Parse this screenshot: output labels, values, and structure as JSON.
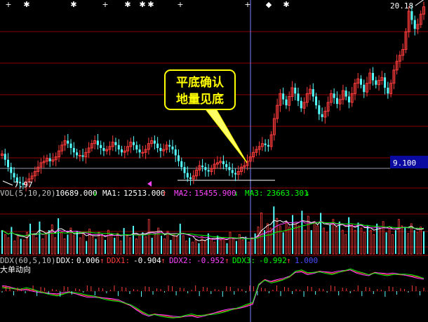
{
  "colors": {
    "background": "#000000",
    "up": "#ff3c3c",
    "down": "#54ffff",
    "grid": "#8b0000",
    "crosshair": "#8080ff",
    "label_white": "#ffffff",
    "ma1": "#ffffff",
    "ma2": "#ff44ff",
    "ma3": "#00ff00",
    "ddx1": "#ff3c3c",
    "ddx2": "#ff44ff",
    "ddx3": "#00ff00",
    "ddx_extra": "#4a4aff",
    "callout_bg": "#ffff00",
    "callout_text": "#000000",
    "price_tag_bg": "#0a0aa0"
  },
  "price_panel": {
    "high_label": "20.18",
    "low_label": "7.97",
    "current_price": "9.100",
    "annotation_line1": "平底确认",
    "annotation_line2": "地量见底",
    "top_markers": [
      "+",
      "✱",
      "✱",
      "+",
      "✱",
      "✱",
      "✱",
      "+",
      "+",
      "◆",
      "✱"
    ]
  },
  "volume_panel": {
    "title": "VOL(5,10,20)",
    "value": "10689.000",
    "value_arrow": "↓",
    "ma1_label": "MA1:",
    "ma1_value": "12513.000",
    "ma1_arrow": "↑",
    "ma2_label": "MA2:",
    "ma2_value": "15455.900",
    "ma2_arrow": "↓",
    "ma3_label": "MA3:",
    "ma3_value": "23663.301",
    "ma3_arrow": "↓"
  },
  "ddx_panel": {
    "title": "DDX(60,5,10)",
    "subtitle": "大单动向",
    "ddx_label": "DDX:",
    "ddx_value": "0.006",
    "ddx_arrow": "↑",
    "ddx1_label": "DDX1:",
    "ddx1_value": "-0.904",
    "ddx1_arrow": "↑",
    "ddx2_label": "DDX2:",
    "ddx2_value": "-0.952",
    "ddx2_arrow": "↑",
    "ddx3_label": "DDX3:",
    "ddx3_value": "-0.992",
    "ddx3_arrow": "↑",
    "extra_value": "1.000"
  },
  "chart_data": {
    "type": "candlestick",
    "panels": [
      "price",
      "volume",
      "ddx"
    ],
    "price_range": [
      7.97,
      20.18
    ],
    "current_price": 9.1,
    "price_series": [
      10.1,
      9.7,
      9.2,
      8.8,
      8.5,
      8.2,
      8.1,
      8.0,
      8.2,
      8.4,
      8.6,
      8.9,
      9.2,
      9.5,
      9.6,
      9.8,
      9.6,
      9.7,
      9.9,
      10.3,
      10.7,
      11.0,
      10.8,
      10.5,
      10.2,
      10.0,
      10.0,
      9.9,
      10.2,
      10.5,
      10.8,
      11.0,
      10.7,
      10.5,
      10.3,
      10.4,
      10.6,
      10.9,
      10.7,
      10.4,
      10.2,
      10.3,
      10.6,
      10.9,
      10.7,
      10.4,
      10.2,
      10.2,
      10.4,
      10.8,
      11.0,
      10.8,
      10.5,
      10.3,
      10.4,
      10.7,
      10.6,
      10.4,
      10.0,
      9.6,
      9.2,
      8.8,
      8.5,
      8.4,
      8.6,
      9.0,
      9.3,
      9.2,
      9.0,
      8.9,
      9.1,
      9.4,
      9.5,
      9.6,
      9.4,
      9.2,
      9.0,
      8.8,
      8.7,
      8.9,
      9.2,
      9.3,
      9.6,
      9.9,
      10.2,
      10.4,
      10.6,
      10.8,
      10.7,
      10.6,
      11.4,
      12.5,
      13.4,
      14.2,
      13.8,
      13.4,
      14.0,
      14.6,
      14.2,
      13.7,
      13.2,
      13.6,
      14.2,
      14.5,
      14.0,
      13.4,
      12.8,
      12.6,
      13.0,
      13.6,
      14.2,
      13.9,
      13.5,
      13.8,
      14.4,
      14.0,
      13.6,
      14.2,
      14.9,
      15.2,
      14.8,
      14.3,
      14.9,
      15.6,
      15.1,
      14.8,
      15.1,
      15.3,
      14.6,
      14.2,
      14.9,
      15.8,
      16.4,
      16.8,
      17.2,
      18.4,
      19.8,
      19.2,
      18.6,
      18.9,
      19.6,
      20.1
    ],
    "volume_series": [
      22,
      18,
      15,
      25,
      12,
      16,
      14,
      13,
      20,
      28,
      18,
      15,
      30,
      14,
      19,
      22,
      27,
      15,
      33,
      20,
      14,
      18,
      24,
      17,
      21,
      15,
      19,
      12,
      23,
      16,
      14,
      20,
      17,
      13,
      22,
      18,
      15,
      19,
      12,
      24,
      17,
      15,
      26,
      14,
      18,
      20,
      16,
      32,
      15,
      18,
      24,
      17,
      14,
      21,
      13,
      19,
      16,
      28,
      17,
      12,
      15,
      11,
      13,
      10,
      16,
      12,
      19,
      14,
      11,
      17,
      13,
      15,
      10,
      20,
      14,
      12,
      18,
      13,
      16,
      11,
      15,
      19,
      25,
      38,
      22,
      28,
      24,
      44,
      33,
      26,
      20,
      30,
      25,
      36,
      28,
      26,
      40,
      22,
      35,
      22,
      30,
      26,
      38,
      24,
      20,
      27,
      32,
      25,
      30,
      22,
      18,
      34,
      27,
      22,
      29,
      24,
      20,
      26,
      22,
      18,
      28,
      24,
      30,
      20,
      25,
      18,
      22,
      32,
      26,
      24,
      19,
      28,
      22,
      20,
      25,
      21
    ],
    "ddx_series": [
      0.2,
      0.15,
      0.1,
      0.05,
      0.1,
      0.05,
      0.0,
      -0.05,
      -0.1,
      -0.15,
      -0.1,
      -0.05,
      -0.1,
      -0.15,
      -0.2,
      -0.2,
      -0.25,
      -0.3,
      -0.35,
      -0.4,
      -0.5,
      -0.6,
      -0.75,
      -0.9,
      -1.0,
      -0.95,
      -1.0,
      -1.05,
      -1.1,
      -1.1,
      -1.05,
      -1.0,
      -1.05,
      -1.0,
      -0.95,
      -0.9,
      -0.85,
      -0.8,
      -0.75,
      -0.7,
      -0.6,
      -0.5,
      0.3,
      0.5,
      0.4,
      0.45,
      0.5,
      0.6,
      0.8,
      0.85,
      0.75,
      0.8,
      0.85,
      0.8,
      0.75,
      0.8,
      0.85,
      0.9,
      0.8,
      0.75,
      0.7,
      0.8,
      0.75,
      0.7,
      0.72,
      0.7,
      0.68,
      0.65,
      0.6,
      0.55
    ]
  }
}
